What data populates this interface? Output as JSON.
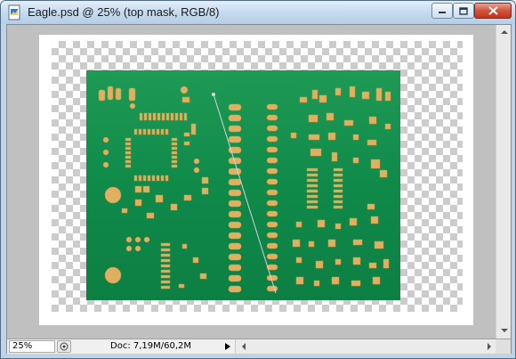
{
  "window": {
    "title": "Eagle.psd @ 25% (top mask, RGB/8)"
  },
  "status": {
    "zoom": "25%",
    "doc_info": "Doc: 7,19M/60,2M"
  },
  "colors": {
    "board_green": "#0f8a49",
    "pad_gold": "#e0b060",
    "canvas_gray": "#c0c0c0"
  },
  "icons": {
    "app": "photoshop-doc-icon",
    "minimize": "minimize-icon",
    "maximize": "maximize-icon",
    "close": "close-icon"
  }
}
